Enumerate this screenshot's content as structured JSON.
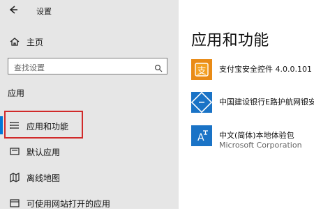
{
  "window": {
    "title": "设置"
  },
  "sidebar": {
    "home_label": "主页",
    "search_placeholder": "查找设置",
    "section_title": "应用",
    "items": [
      {
        "label": "应用和功能"
      },
      {
        "label": "默认应用"
      },
      {
        "label": "离线地图"
      },
      {
        "label": "可使用网站打开的应用"
      }
    ]
  },
  "main": {
    "title": "应用和功能",
    "apps": [
      {
        "name": "支付宝安全控件 4.0.0.101",
        "publisher": "",
        "icon": "alipay-icon"
      },
      {
        "name": "中国建设银行E路护航网银安",
        "publisher": "",
        "icon": "ccb-icon"
      },
      {
        "name": "中文(简体)本地体验包",
        "publisher": "Microsoft Corporation",
        "icon": "language-pack-icon"
      }
    ]
  },
  "colors": {
    "accent": "#0078d7",
    "highlight": "#d12a2a",
    "tile_blue": "#1a73c6",
    "alipay_tile": "#e98b16"
  }
}
